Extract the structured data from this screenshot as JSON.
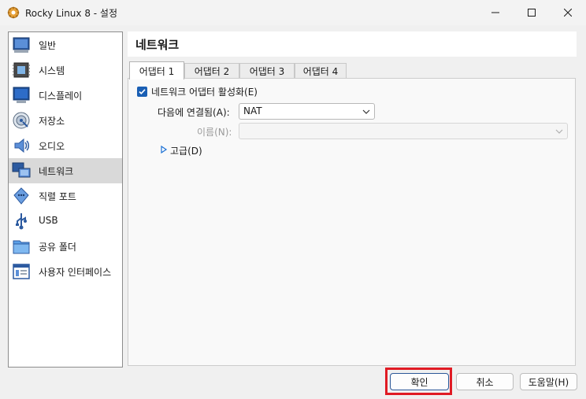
{
  "window": {
    "title": "Rocky Linux 8 - 설정"
  },
  "sidebar": {
    "items": [
      {
        "label": "일반",
        "icon": "general-icon"
      },
      {
        "label": "시스템",
        "icon": "system-icon"
      },
      {
        "label": "디스플레이",
        "icon": "display-icon"
      },
      {
        "label": "저장소",
        "icon": "storage-icon"
      },
      {
        "label": "오디오",
        "icon": "audio-icon"
      },
      {
        "label": "네트워크",
        "icon": "network-icon"
      },
      {
        "label": "직렬 포트",
        "icon": "serial-port-icon"
      },
      {
        "label": "USB",
        "icon": "usb-icon"
      },
      {
        "label": "공유 폴더",
        "icon": "shared-folder-icon"
      },
      {
        "label": "사용자 인터페이스",
        "icon": "user-interface-icon"
      }
    ],
    "selected": "네트워크"
  },
  "main": {
    "section_title": "네트워크",
    "tabs": [
      {
        "label": "어댑터 1"
      },
      {
        "label": "어댑터 2"
      },
      {
        "label": "어댑터 3"
      },
      {
        "label": "어댑터 4"
      }
    ],
    "active_tab": "어댑터 1",
    "enable_adapter": {
      "label": "네트워크 어댑터 활성화(E)",
      "checked": true
    },
    "attached_to": {
      "label": "다음에 연결됨(A):",
      "value": "NAT"
    },
    "name": {
      "label": "이름(N):",
      "value": ""
    },
    "advanced": {
      "label": "고급(D)"
    }
  },
  "buttons": {
    "ok": "확인",
    "cancel": "취소",
    "help": "도움말(H)"
  },
  "colors": {
    "accent": "#1a5fb4",
    "highlight": "#e01b24",
    "selected_bg": "#d9d9d9"
  }
}
